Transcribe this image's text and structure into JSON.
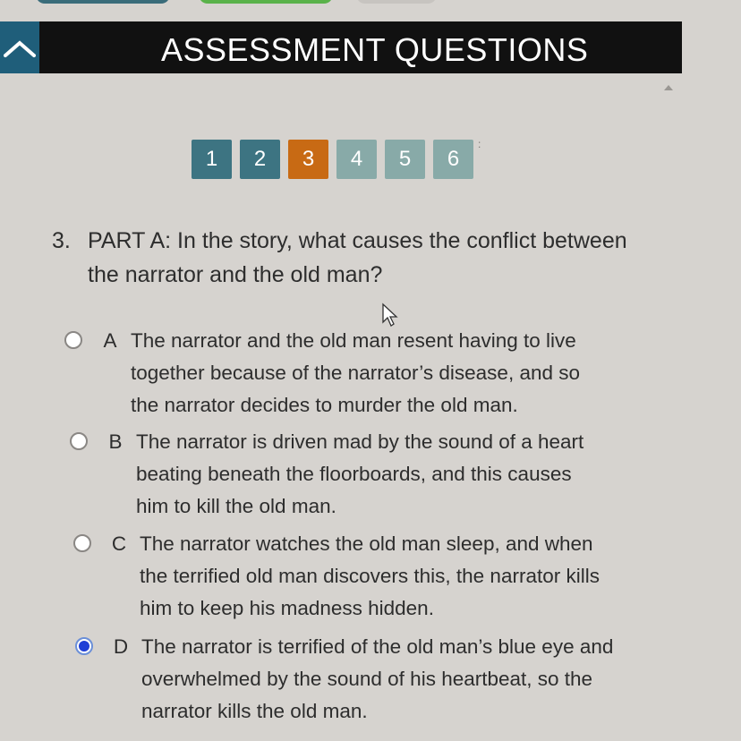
{
  "header": {
    "title": "ASSESSMENT QUESTIONS"
  },
  "question_nav": {
    "items": [
      {
        "label": "1",
        "state": "answered"
      },
      {
        "label": "2",
        "state": "answered"
      },
      {
        "label": "3",
        "state": "current"
      },
      {
        "label": "4",
        "state": "unanswered"
      },
      {
        "label": "5",
        "state": "unanswered"
      },
      {
        "label": "6",
        "state": "unanswered"
      }
    ]
  },
  "question": {
    "number": "3.",
    "text": "PART A: In the story, what causes the conflict between the narrator and the old man?"
  },
  "options": [
    {
      "letter": "A",
      "text": "The narrator and the old man resent having to live together because of the narrator’s disease, and so the narrator decides to murder the old man.",
      "selected": false
    },
    {
      "letter": "B",
      "text": "The narrator is driven mad by the sound of a heart beating beneath the floorboards, and this causes him to kill the old man.",
      "selected": false
    },
    {
      "letter": "C",
      "text": "The narrator watches the old man sleep, and when the terrified old man discovers this, the narrator kills him to keep his madness hidden.",
      "selected": false
    },
    {
      "letter": "D",
      "text": "The narrator is terrified of the old man’s blue eye and overwhelmed by the sound of his heartbeat, so the narrator kills the old man.",
      "selected": true
    }
  ],
  "colors": {
    "header_bg": "#111111",
    "nav_answered": "#3d7482",
    "nav_current": "#c86a14",
    "nav_unanswered": "#88aaa8",
    "radio_selected": "#1f3fd6"
  }
}
